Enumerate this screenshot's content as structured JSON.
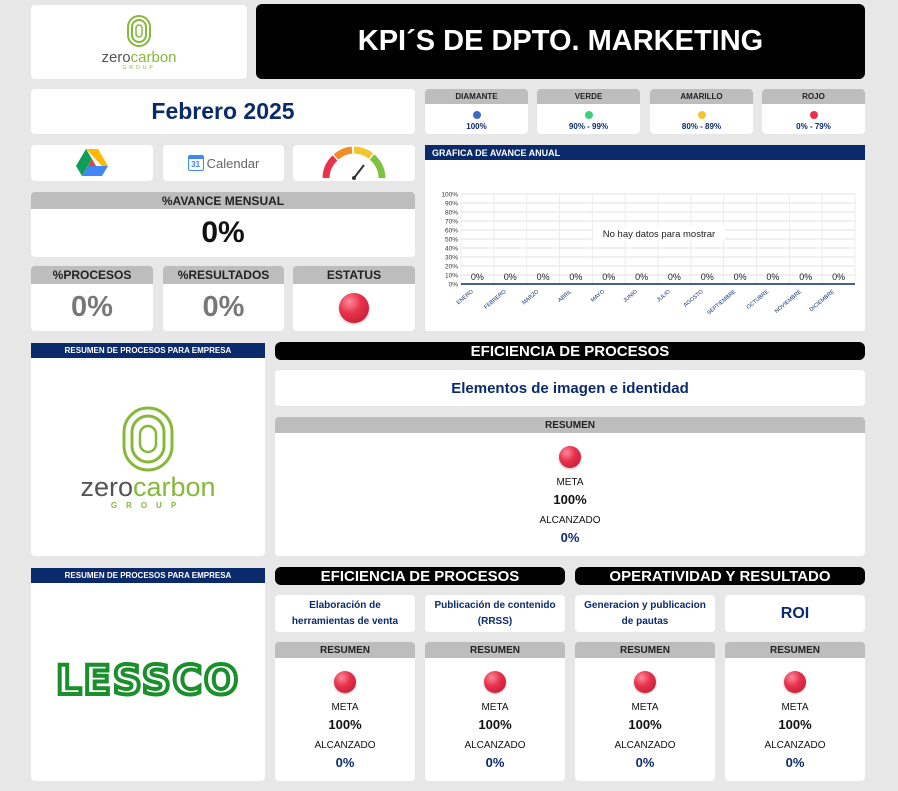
{
  "title": "KPI´S DE DPTO. MARKETING",
  "period": "Febrero 2025",
  "brand": {
    "zc_name_a": "zero",
    "zc_name_b": "carbon",
    "zc_group": "GROUP",
    "lessco": "LESSCO"
  },
  "legend": [
    {
      "label": "DIAMANTE",
      "range": "100%",
      "color": "#3d6cc4"
    },
    {
      "label": "VERDE",
      "range": "90% - 99%",
      "color": "#3fcf7a"
    },
    {
      "label": "AMARILLO",
      "range": "80% - 89%",
      "color": "#f2c531"
    },
    {
      "label": "ROJO",
      "range": "0% - 79%",
      "color": "#e8324d"
    }
  ],
  "apps": {
    "calendar_label": "Calendar",
    "calendar_day": "31"
  },
  "kpis": {
    "avance_label": "%AVANCE MENSUAL",
    "avance_value": "0%",
    "procesos_label": "%PROCESOS",
    "procesos_value": "0%",
    "resultados_label": "%RESULTADOS",
    "resultados_value": "0%",
    "estatus_label": "ESTATUS"
  },
  "chart": {
    "header": "GRAFICA DE AVANCE ANUAL",
    "no_data": "No hay datos para mostrar",
    "yticks": [
      "100%",
      "90%",
      "80%",
      "70%",
      "60%",
      "50%",
      "40%",
      "30%",
      "20%",
      "10%",
      "0%"
    ]
  },
  "chart_data": {
    "type": "bar",
    "categories": [
      "ENERO",
      "FEBRERO",
      "MARZO",
      "ABRIL",
      "MAYO",
      "JUNIO",
      "JULIO",
      "AGOSTO",
      "SEPTIEMBRE",
      "OCTUBRE",
      "NOVIEMBRE",
      "DICIEMBRE"
    ],
    "values": [
      0,
      0,
      0,
      0,
      0,
      0,
      0,
      0,
      0,
      0,
      0,
      0
    ],
    "data_labels": [
      "0%",
      "0%",
      "0%",
      "0%",
      "0%",
      "0%",
      "0%",
      "0%",
      "0%",
      "0%",
      "0%",
      "0%"
    ],
    "ylim": [
      0,
      100
    ],
    "title": "",
    "grid": true
  },
  "section1": {
    "side_header": "RESUMEN DE PROCESOS PARA EMPRESA",
    "eff_header": "EFICIENCIA DE PROCESOS",
    "item": "Elementos de imagen e identidad",
    "resumen": "RESUMEN",
    "meta_label": "META",
    "meta_value": "100%",
    "alc_label": "ALCANZADO",
    "alc_value": "0%"
  },
  "section2": {
    "side_header": "RESUMEN DE PROCESOS PARA EMPRESA",
    "eff_header": "EFICIENCIA DE PROCESOS",
    "op_header": "OPERATIVIDAD Y RESULTADO",
    "cards": [
      {
        "title": "Elaboración de herramientas de venta",
        "resumen": "RESUMEN",
        "meta_label": "META",
        "meta_value": "100%",
        "alc_label": "ALCANZADO",
        "alc_value": "0%"
      },
      {
        "title": "Publicación de contenido (RRSS)",
        "resumen": "RESUMEN",
        "meta_label": "META",
        "meta_value": "100%",
        "alc_label": "ALCANZADO",
        "alc_value": "0%"
      },
      {
        "title": "Generacion y publicacion de pautas",
        "resumen": "RESUMEN",
        "meta_label": "META",
        "meta_value": "100%",
        "alc_label": "ALCANZADO",
        "alc_value": "0%"
      },
      {
        "title": "ROI",
        "resumen": "RESUMEN",
        "meta_label": "META",
        "meta_value": "100%",
        "alc_label": "ALCANZADO",
        "alc_value": "0%"
      }
    ]
  }
}
